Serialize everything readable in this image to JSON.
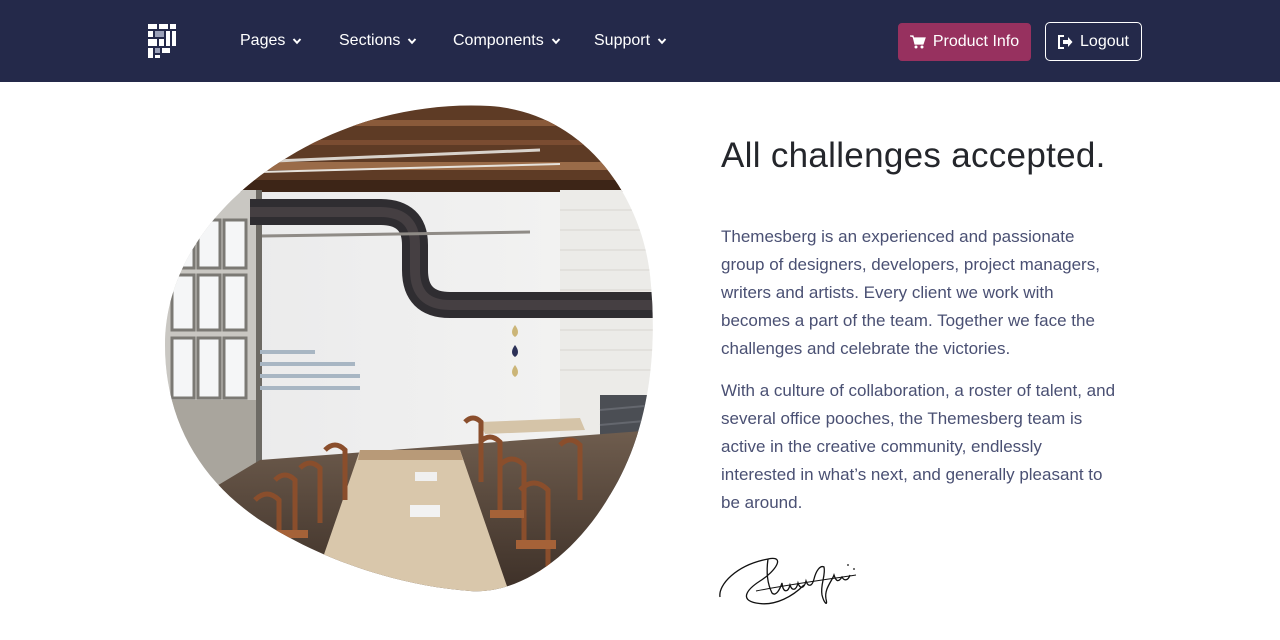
{
  "navbar": {
    "background": "#24294a",
    "brand_icon": "themesberg-logo-icon",
    "items": [
      {
        "label": "Pages",
        "icon": "chevron-down-icon"
      },
      {
        "label": "Sections",
        "icon": "chevron-down-icon"
      },
      {
        "label": "Components",
        "icon": "chevron-down-icon"
      },
      {
        "label": "Support",
        "icon": "chevron-down-icon"
      }
    ],
    "product_button": {
      "label": "Product Info",
      "icon": "cart-icon",
      "color": "#97315f"
    },
    "logout_button": {
      "label": "Logout",
      "icon": "sign-out-icon"
    }
  },
  "main": {
    "image_icon": "office-photo",
    "heading": "All challenges accepted.",
    "paragraphs": [
      "Themesberg is an experienced and passionate group of designers, developers, project managers, writers and artists. Every client we work with becomes a part of the team. Together we face the challenges and celebrate the victories.",
      "With a culture of collaboration, a roster of talent, and several office pooches, the Themesberg team is active in the creative community, endlessly interested in what’s next, and generally pleasant to be around."
    ],
    "signature_icon": "handwritten-signature",
    "text_color": "#4a5073",
    "heading_color": "#24262b"
  }
}
